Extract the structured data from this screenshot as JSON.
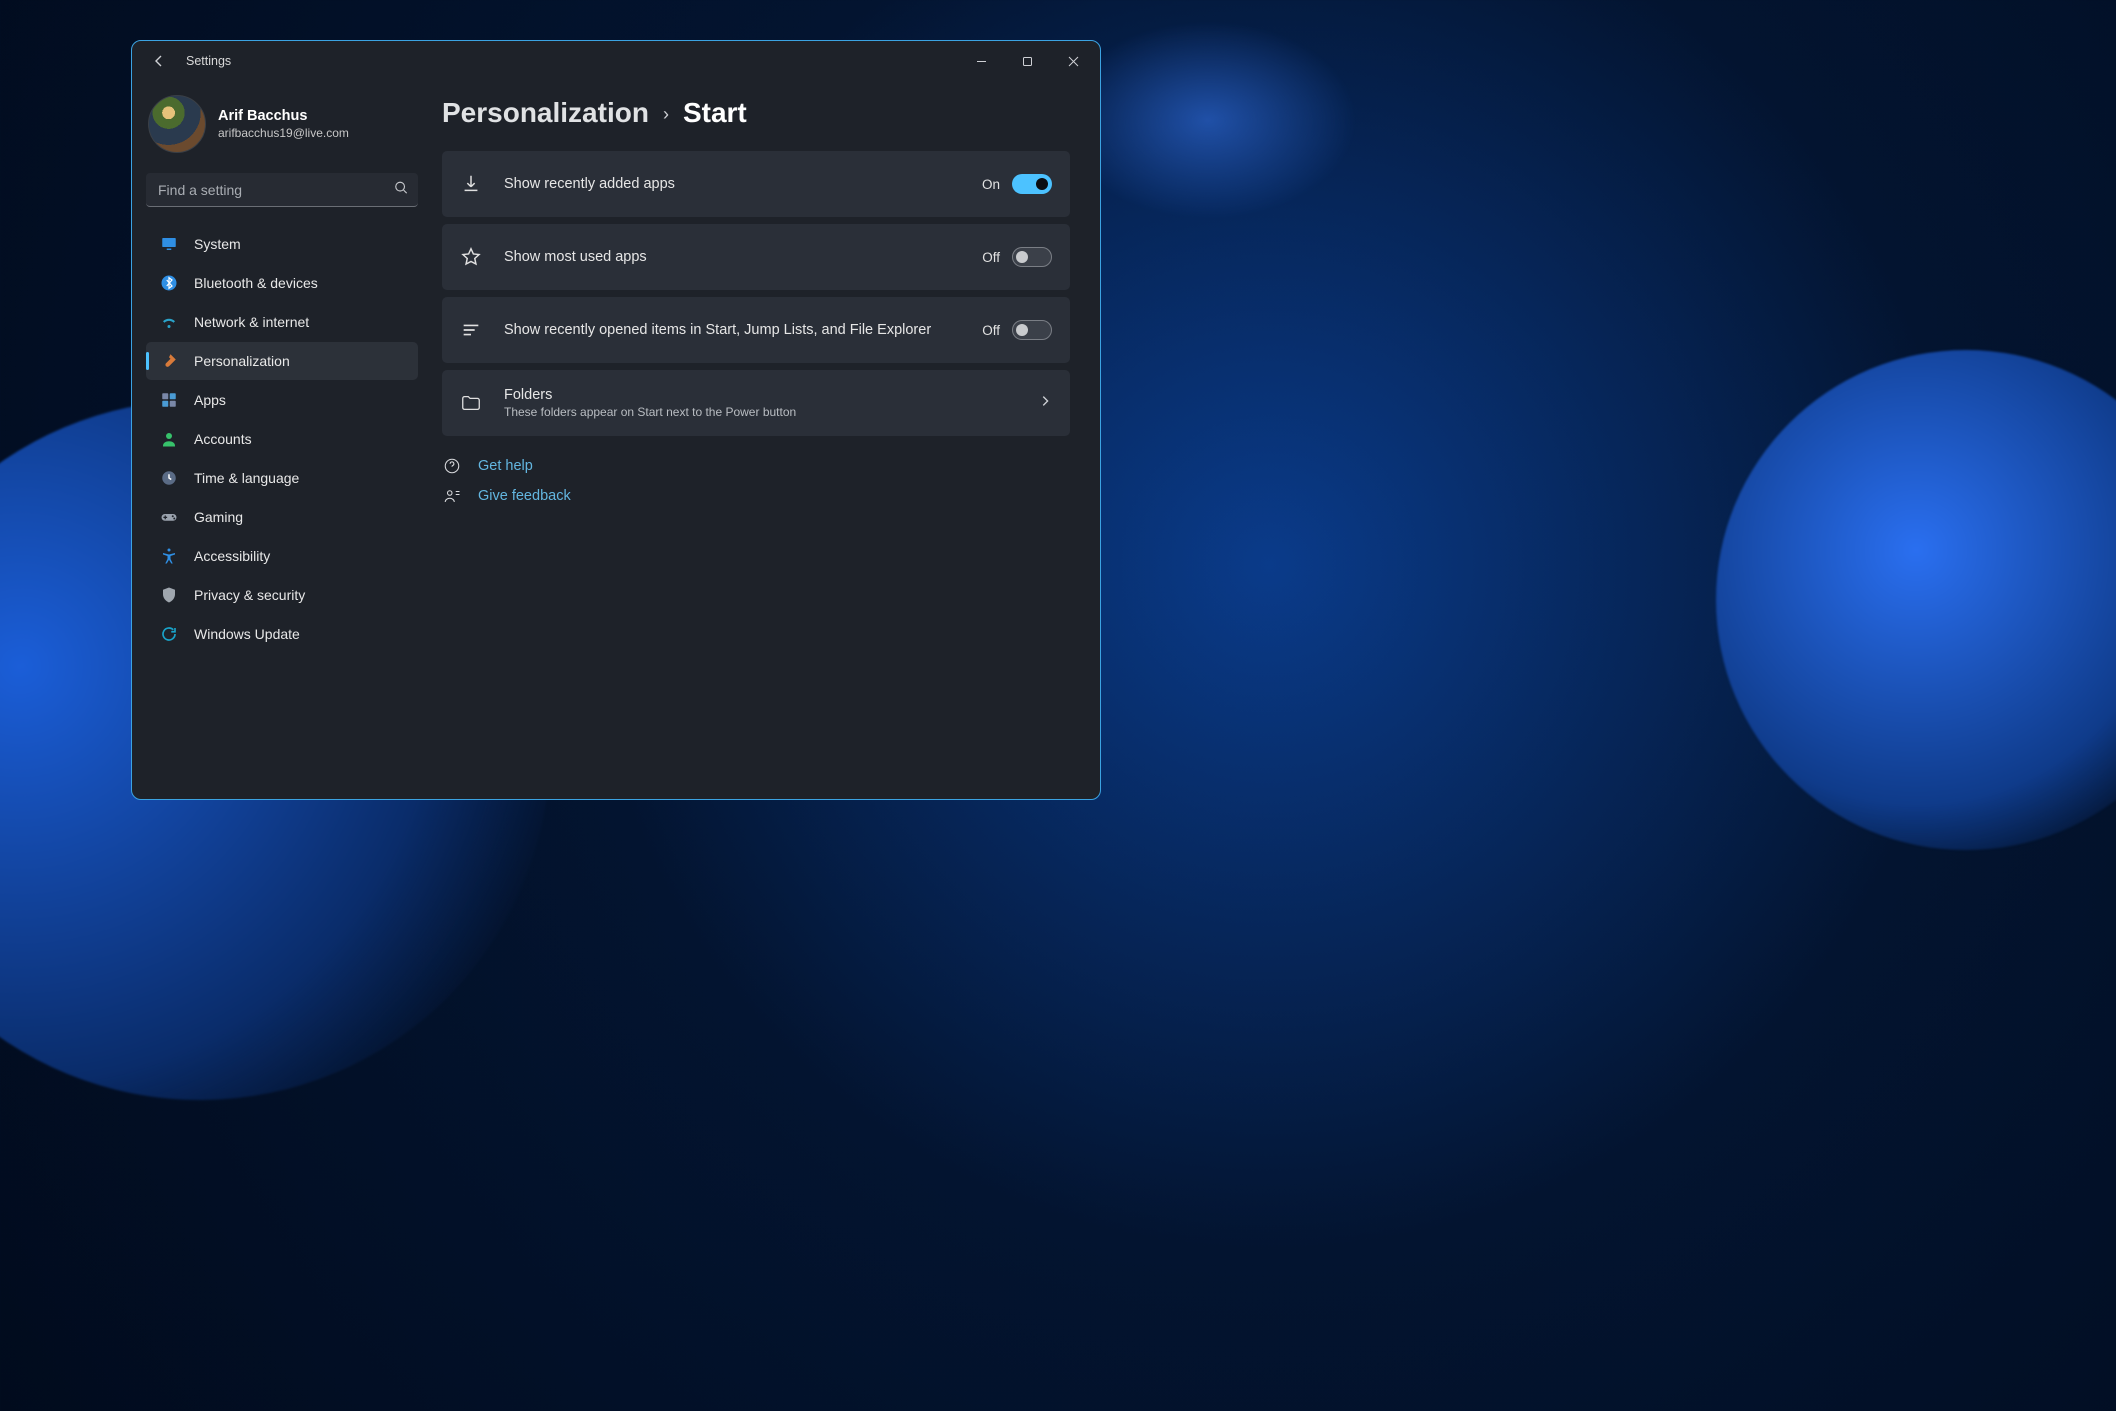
{
  "window": {
    "title": "Settings"
  },
  "profile": {
    "name": "Arif Bacchus",
    "email": "arifbacchus19@live.com"
  },
  "search": {
    "placeholder": "Find a setting"
  },
  "nav": {
    "items": [
      {
        "label": "System",
        "icon": "display-icon",
        "color": "#2f8fe4"
      },
      {
        "label": "Bluetooth & devices",
        "icon": "bluetooth-icon",
        "color": "#2f8fe4"
      },
      {
        "label": "Network & internet",
        "icon": "wifi-icon",
        "color": "#2aa3c9"
      },
      {
        "label": "Personalization",
        "icon": "paintbrush-icon",
        "color": "#d87a3a",
        "active": true
      },
      {
        "label": "Apps",
        "icon": "apps-icon",
        "color": "#7a88a8"
      },
      {
        "label": "Accounts",
        "icon": "person-icon",
        "color": "#37c26b"
      },
      {
        "label": "Time & language",
        "icon": "clock-icon",
        "color": "#b8c3d4"
      },
      {
        "label": "Gaming",
        "icon": "gamepad-icon",
        "color": "#9aa2ad"
      },
      {
        "label": "Accessibility",
        "icon": "accessibility-icon",
        "color": "#2f8fe4"
      },
      {
        "label": "Privacy & security",
        "icon": "shield-icon",
        "color": "#9fa6ae"
      },
      {
        "label": "Windows Update",
        "icon": "update-icon",
        "color": "#19a3c9"
      }
    ]
  },
  "breadcrumb": {
    "parent": "Personalization",
    "current": "Start"
  },
  "settings": [
    {
      "icon": "download-icon",
      "label": "Show recently added apps",
      "state": "On",
      "toggle": true
    },
    {
      "icon": "star-icon",
      "label": "Show most used apps",
      "state": "Off",
      "toggle": false
    },
    {
      "icon": "list-icon",
      "label": "Show recently opened items in Start, Jump Lists, and File Explorer",
      "state": "Off",
      "toggle": false
    }
  ],
  "navcard": {
    "icon": "folder-icon",
    "title": "Folders",
    "subtitle": "These folders appear on Start next to the Power button"
  },
  "links": {
    "help": "Get help",
    "feedback": "Give feedback"
  },
  "labels": {
    "on": "On",
    "off": "Off"
  }
}
